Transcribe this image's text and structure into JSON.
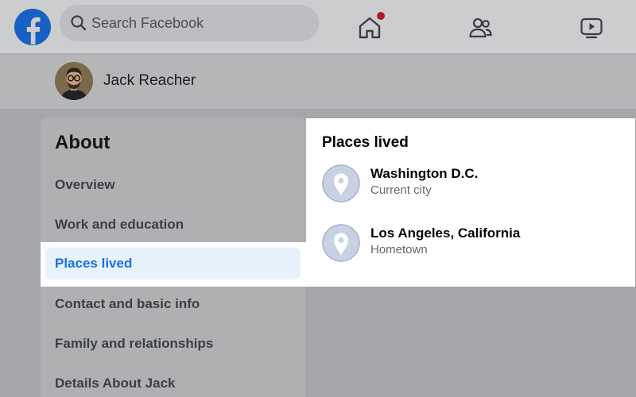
{
  "topbar": {
    "search": {
      "placeholder": "Search Facebook"
    },
    "home_notification": true,
    "brand_color": "#1877f2"
  },
  "profile": {
    "name": "Jack Reacher"
  },
  "about": {
    "title": "About",
    "items": [
      {
        "label": "Overview",
        "active": false
      },
      {
        "label": "Work and education",
        "active": false
      },
      {
        "label": "Places lived",
        "active": true
      },
      {
        "label": "Contact and basic info",
        "active": false
      },
      {
        "label": "Family and relationships",
        "active": false
      },
      {
        "label": "Details About Jack",
        "active": false
      }
    ],
    "active_color": "#1870e2"
  },
  "places": {
    "title": "Places lived",
    "entries": [
      {
        "name": "Washington D.C.",
        "type": "Current city",
        "icon": "map-pin-icon"
      },
      {
        "name": "Los Angeles, California",
        "type": "Hometown",
        "icon": "map-pin-icon"
      }
    ]
  }
}
